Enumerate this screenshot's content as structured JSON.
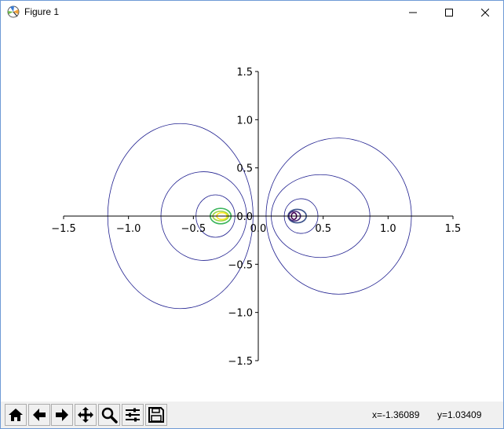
{
  "window": {
    "title": "Figure 1"
  },
  "toolbar": {
    "buttons": [
      {
        "name": "home-icon"
      },
      {
        "name": "back-arrow-icon"
      },
      {
        "name": "forward-arrow-icon"
      },
      {
        "name": "pan-icon"
      },
      {
        "name": "zoom-icon"
      },
      {
        "name": "subplots-config-icon"
      },
      {
        "name": "save-icon"
      }
    ],
    "x_coord": "x=-1.36089",
    "y_coord": "y=1.03409"
  },
  "chart_data": {
    "type": "contour",
    "xlim": [
      -1.5,
      1.5
    ],
    "ylim": [
      -1.5,
      1.5
    ],
    "x_ticks": [
      "−1.5",
      "−1.0",
      "−0.5",
      "0.0",
      "0.5",
      "1.0",
      "1.5"
    ],
    "y_ticks": [
      "1.5",
      "1.0",
      "0.5",
      "0.0",
      "−0.5",
      "−1.0",
      "−1.5"
    ],
    "x_tick_values": [
      -1.5,
      -1.0,
      -0.5,
      0.0,
      0.5,
      1.0,
      1.5
    ],
    "y_tick_values": [
      1.5,
      1.0,
      0.5,
      0.0,
      -0.5,
      -1.0,
      -1.5
    ],
    "spines": "centered",
    "contours": [
      {
        "cx": -0.6,
        "cy": 0.0,
        "rx": 0.56,
        "ry": 0.96,
        "color": "#1f1f8f"
      },
      {
        "cx": -0.42,
        "cy": 0.0,
        "rx": 0.33,
        "ry": 0.46,
        "color": "#1f1f8f"
      },
      {
        "cx": -0.33,
        "cy": 0.0,
        "rx": 0.15,
        "ry": 0.22,
        "color": "#1f1f8f"
      },
      {
        "cx": -0.29,
        "cy": 0.0,
        "rx": 0.08,
        "ry": 0.08,
        "color": "#3cb55c"
      },
      {
        "cx": -0.29,
        "cy": 0.0,
        "rx": 0.06,
        "ry": 0.05,
        "color": "#9bd63f"
      },
      {
        "cx": -0.28,
        "cy": 0.0,
        "rx": 0.04,
        "ry": 0.035,
        "color": "#fde725"
      },
      {
        "cx": 0.62,
        "cy": 0.0,
        "rx": 0.56,
        "ry": 0.81,
        "color": "#1f1f8f"
      },
      {
        "cx": 0.48,
        "cy": 0.0,
        "rx": 0.38,
        "ry": 0.43,
        "color": "#1f1f8f"
      },
      {
        "cx": 0.33,
        "cy": 0.0,
        "rx": 0.13,
        "ry": 0.18,
        "color": "#1f1f8f"
      },
      {
        "cx": 0.3,
        "cy": 0.0,
        "rx": 0.07,
        "ry": 0.07,
        "color": "#3b528b"
      },
      {
        "cx": 0.28,
        "cy": 0.0,
        "rx": 0.045,
        "ry": 0.05,
        "color": "#472d7b"
      },
      {
        "cx": 0.275,
        "cy": 0.0,
        "rx": 0.02,
        "ry": 0.035,
        "color": "#440154"
      }
    ]
  }
}
